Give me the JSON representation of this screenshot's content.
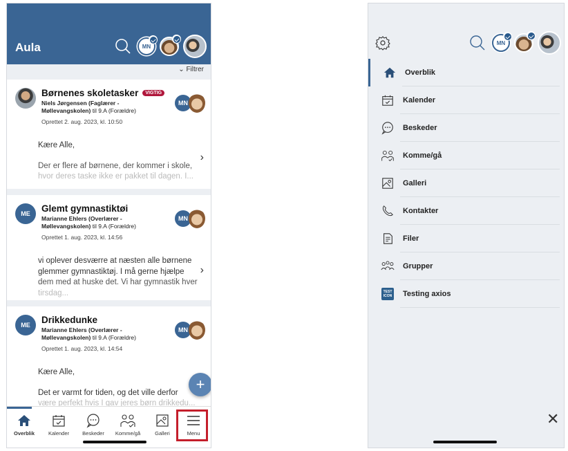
{
  "left": {
    "app_title": "Aula",
    "header_badge": "MN",
    "filter_label": "Filtrer",
    "feed": [
      {
        "title": "Børnenes skoletasker",
        "tag": "VIGTIG",
        "sender_name": "Niels Jørgensen (Faglærer -",
        "sender_school": "Møllevangskolen)",
        "sender_to": " til 9.A (Forældre)",
        "date": "Oprettet 2. aug. 2023, kl. 10:50",
        "recipient_initials": "MN",
        "greeting": "Kære Alle,",
        "body_line1": "Der er flere af børnene, der kommer i skole,",
        "body_line2": "hvor deres taske ikke er pakket til dagen. I..."
      },
      {
        "sender_initials": "ME",
        "title": "Glemt gymnastiktøi",
        "sender_name": "Marianne Ehlers (Overlærer -",
        "sender_school": "Møllevangskolen)",
        "sender_to": " til 9.A (Forældre)",
        "date": "Oprettet 1. aug. 2023, kl. 14:56",
        "recipient_initials": "MN",
        "body_line1": "vi oplever desværre at næsten alle børnene",
        "body_line2": "glemmer gymnastiktøj. I må gerne hjælpe",
        "body_line3": "dem med at huske det. Vi har gymnastik hver",
        "body_line4": "tirsdag..."
      },
      {
        "sender_initials": "ME",
        "title": "Drikkedunke",
        "sender_name": "Marianne Ehlers (Overlærer -",
        "sender_school": "Møllevangskolen)",
        "sender_to": " til 9.A (Forældre)",
        "date": "Oprettet 1. aug. 2023, kl. 14:54",
        "recipient_initials": "MN",
        "greeting": "Kære Alle,",
        "body_line1": "Det er varmt for tiden, og det ville derfor",
        "body_line2": "være perfekt hvis I gav jeres børn drikkedu..."
      }
    ],
    "fab_label": "+",
    "nav": [
      {
        "label": "Overblik"
      },
      {
        "label": "Kalender"
      },
      {
        "label": "Beskeder"
      },
      {
        "label": "Komme/gå"
      },
      {
        "label": "Galleri"
      },
      {
        "label": "Menu"
      }
    ]
  },
  "right": {
    "header_badge": "MN",
    "menu": [
      {
        "label": "Overblik",
        "icon": "home-icon"
      },
      {
        "label": "Kalender",
        "icon": "calendar-icon"
      },
      {
        "label": "Beskeder",
        "icon": "chat-bubble-icon"
      },
      {
        "label": "Komme/gå",
        "icon": "people-check-icon"
      },
      {
        "label": "Galleri",
        "icon": "image-icon"
      },
      {
        "label": "Kontakter",
        "icon": "phone-icon"
      },
      {
        "label": "Filer",
        "icon": "file-icon"
      },
      {
        "label": "Grupper",
        "icon": "group-icon"
      },
      {
        "label": "Testing axios",
        "icon": "test-icon",
        "icon_text_1": "TEST",
        "icon_text_2": "ICON"
      }
    ],
    "close_label": "✕"
  },
  "colors": {
    "primary": "#3a6594",
    "tag_red": "#b0173c",
    "highlight_red": "#c41e2b",
    "fab": "#5b84b3"
  }
}
